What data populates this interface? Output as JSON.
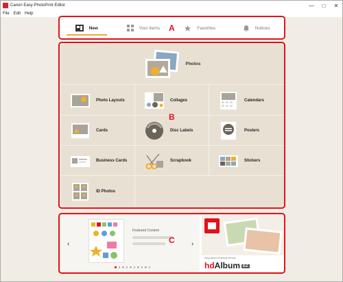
{
  "window": {
    "title": "Canon Easy-PhotoPrint Editor",
    "controls": [
      "—",
      "□",
      "✕"
    ]
  },
  "menu": [
    "File",
    "Edit",
    "Help"
  ],
  "tabs": [
    {
      "label": "New",
      "icon": "new-icon",
      "active": true
    },
    {
      "label": "Your items",
      "icon": "your-items-icon",
      "active": false
    },
    {
      "label": "Favorites",
      "icon": "star-icon",
      "active": false
    },
    {
      "label": "Notices",
      "icon": "bell-icon",
      "active": false
    }
  ],
  "callouts": {
    "a": "A",
    "b": "B",
    "c": "C"
  },
  "grid": {
    "photos": "Photos",
    "items": [
      {
        "label": "Photo Layouts",
        "icon": "photo-layouts-icon"
      },
      {
        "label": "Collages",
        "icon": "collages-icon"
      },
      {
        "label": "Calendars",
        "icon": "calendar-icon"
      },
      {
        "label": "Cards",
        "icon": "cards-icon"
      },
      {
        "label": "Disc Labels",
        "icon": "disc-icon"
      },
      {
        "label": "Posters",
        "icon": "posters-icon"
      },
      {
        "label": "Business Cards",
        "icon": "business-cards-icon"
      },
      {
        "label": "Scrapbook",
        "icon": "scrapbook-icon"
      },
      {
        "label": "Stickers",
        "icon": "stickers-icon"
      },
      {
        "label": "ID Photos",
        "icon": "id-photos-icon"
      }
    ]
  },
  "featured": {
    "title": "Featured Content",
    "prev": "‹",
    "next": "›",
    "dots": 10,
    "active_dot": 0,
    "hd_subtitle": "Easy Album Ordering Service",
    "hd_brand_a": "hd",
    "hd_brand_b": "Album",
    "hd_badge": "EZ"
  },
  "colors": {
    "accent": "#e3101b",
    "tab_underline": "#f0a830",
    "grid_bg": "#e8e1d3"
  }
}
